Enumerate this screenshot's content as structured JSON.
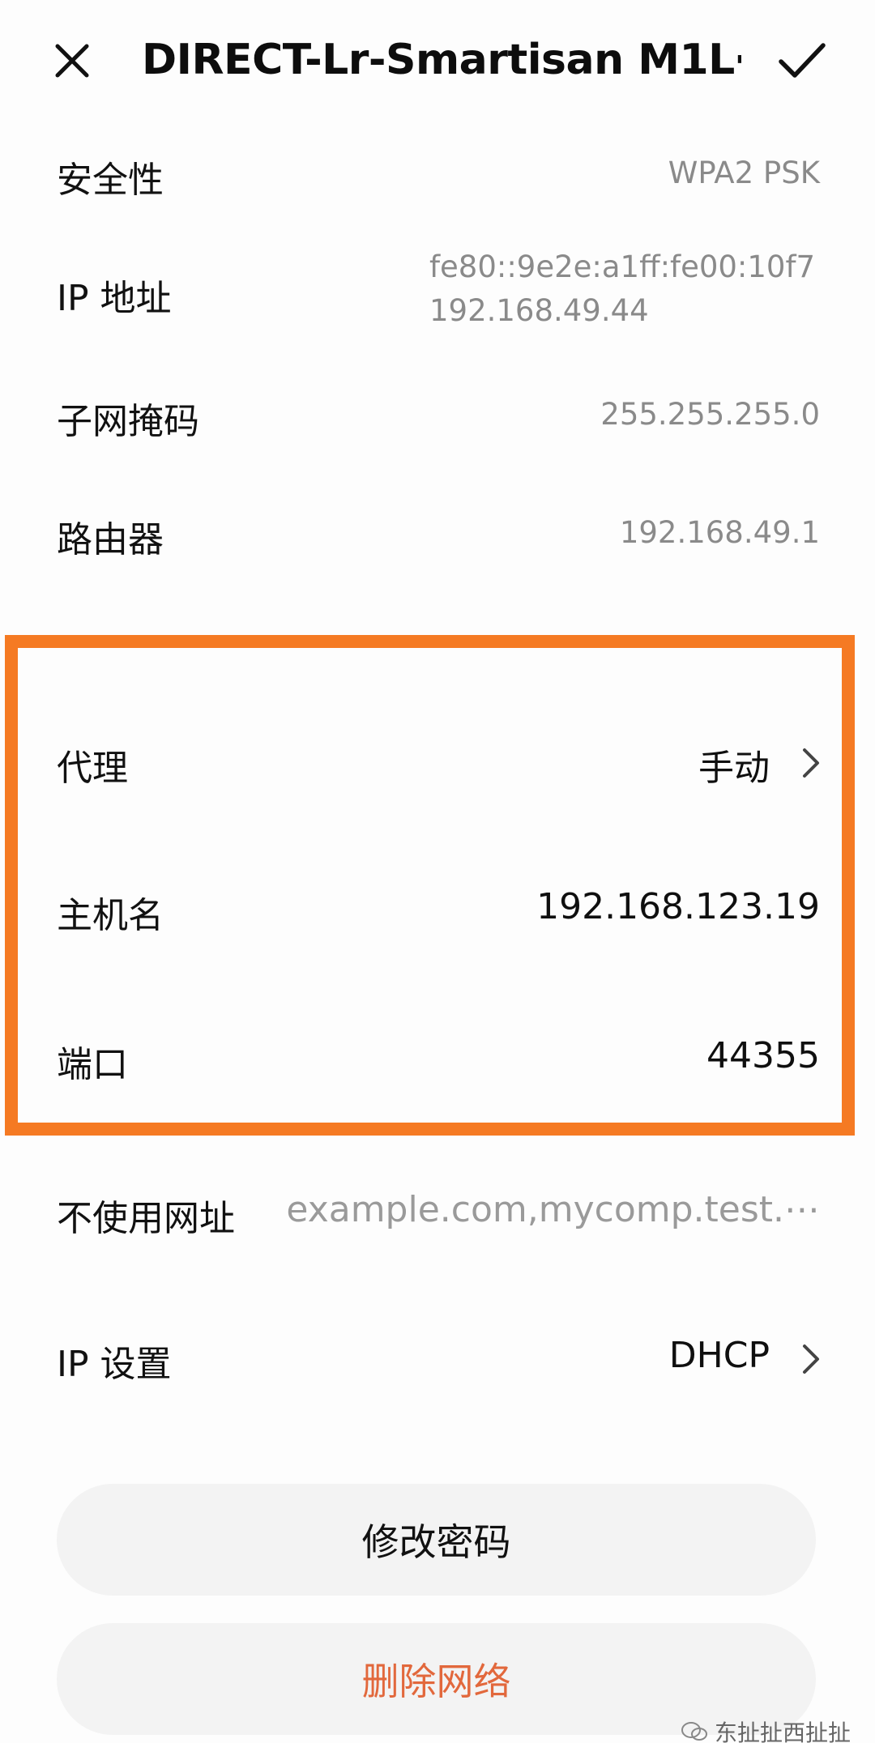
{
  "header": {
    "title": "DIRECT-Lr-Smartisan M1L⋯",
    "close_icon": "close-icon",
    "confirm_icon": "check-icon"
  },
  "details": {
    "security": {
      "label": "安全性",
      "value": "WPA2 PSK"
    },
    "ip_address": {
      "label": "IP 地址",
      "value_v6": "fe80::9e2e:a1ff:fe00:10f7",
      "value_v4": "192.168.49.44"
    },
    "subnet_mask": {
      "label": "子网掩码",
      "value": "255.255.255.0"
    },
    "router": {
      "label": "路由器",
      "value": "192.168.49.1"
    }
  },
  "proxy": {
    "mode": {
      "label": "代理",
      "value": "手动"
    },
    "hostname": {
      "label": "主机名",
      "value": "192.168.123.19"
    },
    "port": {
      "label": "端口",
      "value": "44355"
    },
    "bypass": {
      "label": "不使用网址",
      "placeholder": "example.com,mycomp.test.⋯"
    }
  },
  "ip_settings": {
    "label": "IP 设置",
    "value": "DHCP"
  },
  "buttons": {
    "change_password": "修改密码",
    "delete_network": "删除网络"
  },
  "watermark": {
    "text": "东扯扯西扯扯"
  },
  "colors": {
    "highlight": "#f57a23",
    "delete_text": "#e2683c",
    "secondary_text": "#8a8a8a"
  }
}
